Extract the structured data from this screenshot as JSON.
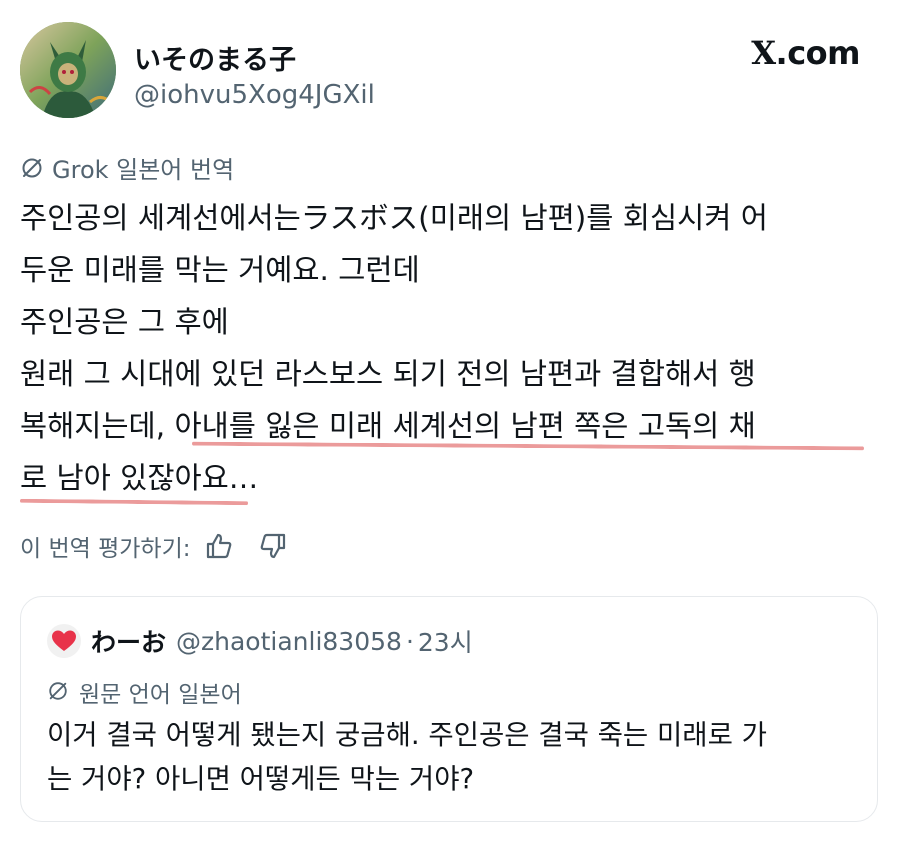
{
  "author": {
    "display_name": "いそのまる子",
    "handle": "@iohvu5Xog4JGXil"
  },
  "source": {
    "brand": "X",
    "domain": ".com"
  },
  "translation": {
    "label": "Grok 일본어 번역",
    "icon": "grok-icon"
  },
  "body": {
    "lines": [
      "주인공의 세계선에서는ラスボス(미래의 남편)를 회심시켜 어",
      "두운 미래를 막는 거예요. 그런데",
      "주인공은 그 후에",
      "원래 그 시대에 있던 라스보스 되기 전의 남편과 결합해서 행",
      "복해지는데, 아내를 잃은 미래 세계선의 남편 쪽은 고독의 채",
      "로 남아 있잖아요…"
    ],
    "highlight_color": "#e88a8a"
  },
  "rating": {
    "label": "이 번역 평가하기:",
    "thumbs_up_icon": "thumbs-up-icon",
    "thumbs_down_icon": "thumbs-down-icon"
  },
  "quote": {
    "avatar_icon": "heart-icon",
    "avatar_color": "#e8334a",
    "display_name": "わーお",
    "handle": "@zhaotianli83058",
    "separator": "·",
    "time": "23시",
    "lang_label": "원문 언어 일본어",
    "lines": [
      "이거 결국 어떻게 됐는지 궁금해. 주인공은 결국 죽는 미래로 가",
      "는 거야? 아니면 어떻게든 막는 거야?"
    ]
  },
  "colors": {
    "text": "#0f1419",
    "muted": "#536471",
    "border": "#e6e9ec"
  }
}
